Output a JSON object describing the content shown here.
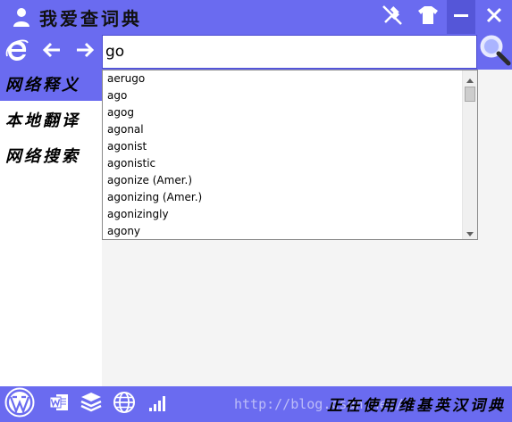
{
  "titlebar": {
    "title": "我爱查词典",
    "icons": [
      "user-icon",
      "pin-icon",
      "tshirt-icon",
      "minimize-icon",
      "close-icon"
    ]
  },
  "navbar": {
    "icons": [
      "ie-icon",
      "back-arrow-icon",
      "forward-arrow-icon",
      "search-magnifier-icon"
    ]
  },
  "search": {
    "value": "go",
    "placeholder": ""
  },
  "sidebar": {
    "items": [
      {
        "label": "网络释义",
        "active": true
      },
      {
        "label": "本地翻译",
        "active": false
      },
      {
        "label": "网络搜索",
        "active": false
      }
    ]
  },
  "dropdown": {
    "items": [
      "aerugo",
      "ago",
      "agog",
      "agonal",
      "agonist",
      "agonistic",
      "agonize (Amer.)",
      "agonizing (Amer.)",
      "agonizingly",
      "agony"
    ]
  },
  "bottombar": {
    "icons": [
      "wordpress-icon",
      "word-doc-icon",
      "layers-icon",
      "globe-icon",
      "signal-icon"
    ],
    "watermark": "http://blog.csdn.net/",
    "status": "正在使用维基英汉词典"
  },
  "colors": {
    "accent": "#6a6bf0",
    "content_bg": "#f4f4f4"
  }
}
